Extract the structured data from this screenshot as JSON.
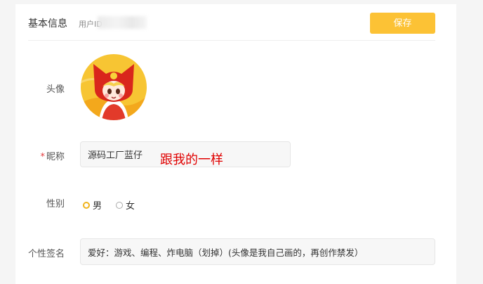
{
  "header": {
    "title": "基本信息",
    "uid_label": "用户ID",
    "save_label": "保存"
  },
  "form": {
    "avatar_label": "头像",
    "nickname": {
      "required_mark": "*",
      "label": "昵称",
      "value": "源码工厂蓝仔"
    },
    "annotation": "跟我的一样",
    "gender": {
      "label": "性别",
      "options": [
        "男",
        "女"
      ],
      "selected": "男"
    },
    "signature": {
      "label": "个性签名",
      "value": "爱好：游戏、编程、炸电脑（划掉）(头像是我自己画的，再创作禁发）"
    }
  },
  "colors": {
    "accent": "#fcc235",
    "annotation": "#e00000"
  }
}
